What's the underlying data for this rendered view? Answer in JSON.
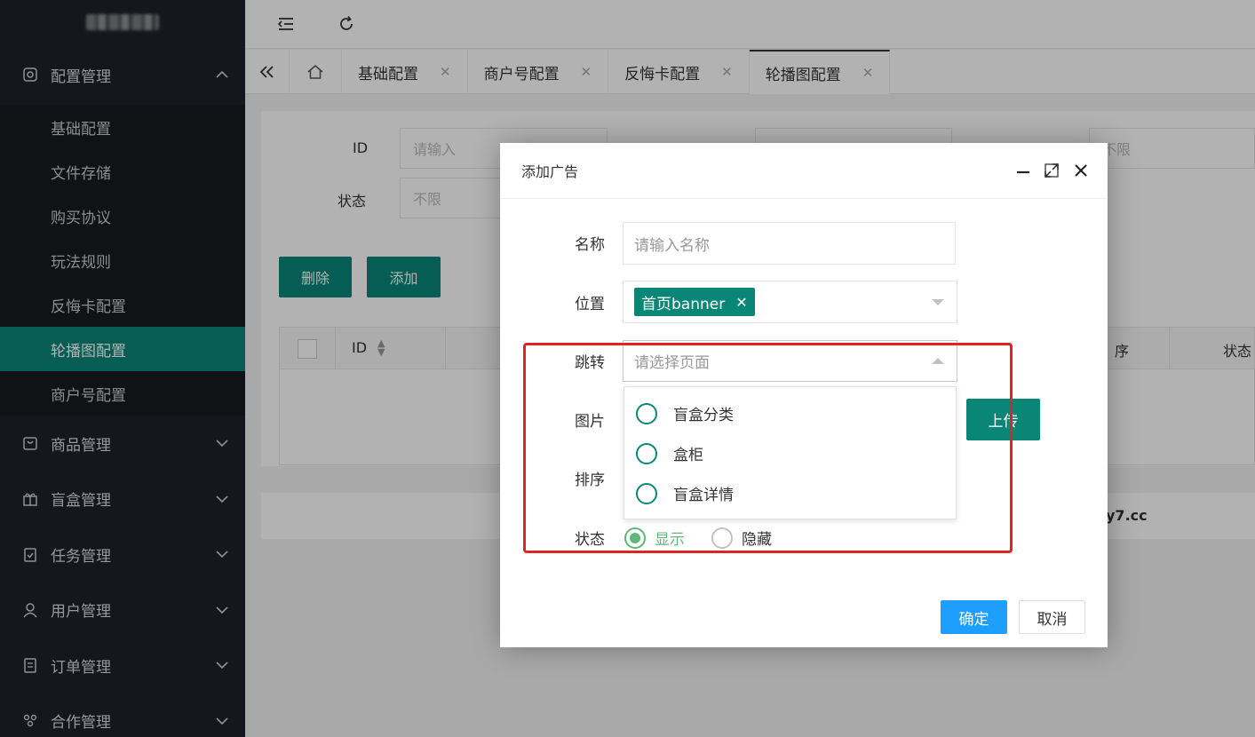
{
  "sidebar": {
    "groups": [
      {
        "label": "配置管理",
        "icon": "gear-icon",
        "open": true
      },
      {
        "label": "商品管理",
        "icon": "bag-icon"
      },
      {
        "label": "盲盒管理",
        "icon": "gift-icon"
      },
      {
        "label": "任务管理",
        "icon": "clipboard-check-icon"
      },
      {
        "label": "用户管理",
        "icon": "user-icon"
      },
      {
        "label": "订单管理",
        "icon": "receipt-icon"
      },
      {
        "label": "合作管理",
        "icon": "group-icon"
      }
    ],
    "config_items": [
      "基础配置",
      "文件存储",
      "购买协议",
      "玩法规则",
      "反悔卡配置",
      "轮播图配置",
      "商户号配置"
    ]
  },
  "tabs": [
    "基础配置",
    "商户号配置",
    "反悔卡配置",
    "轮播图配置"
  ],
  "filter": {
    "id_label": "ID",
    "id_placeholder": "请输入",
    "status_label": "状态",
    "status_value": "不限",
    "position_value": "不限"
  },
  "toolbar": {
    "delete": "删除",
    "add": "添加"
  },
  "table": {
    "col_id": "ID",
    "col_sort_partial": "序",
    "col_status": "状态"
  },
  "footer_partial": "y7.cc",
  "modal": {
    "title": "添加广告",
    "name_label": "名称",
    "name_placeholder": "请输入名称",
    "position_label": "位置",
    "position_tag": "首页banner",
    "jump_label": "跳转",
    "jump_placeholder": "请选择页面",
    "jump_options": [
      "盲盒分类",
      "盒柜",
      "盲盒详情"
    ],
    "image_label": "图片",
    "upload": "上传",
    "sort_label": "排序",
    "status_label": "状态",
    "status_options": [
      "显示",
      "隐藏"
    ],
    "ok": "确定",
    "cancel": "取消"
  },
  "colors": {
    "primary": "#0a8677",
    "sidebar": "#20222a",
    "ok": "#1e9fff",
    "annotation": "#e02424"
  }
}
